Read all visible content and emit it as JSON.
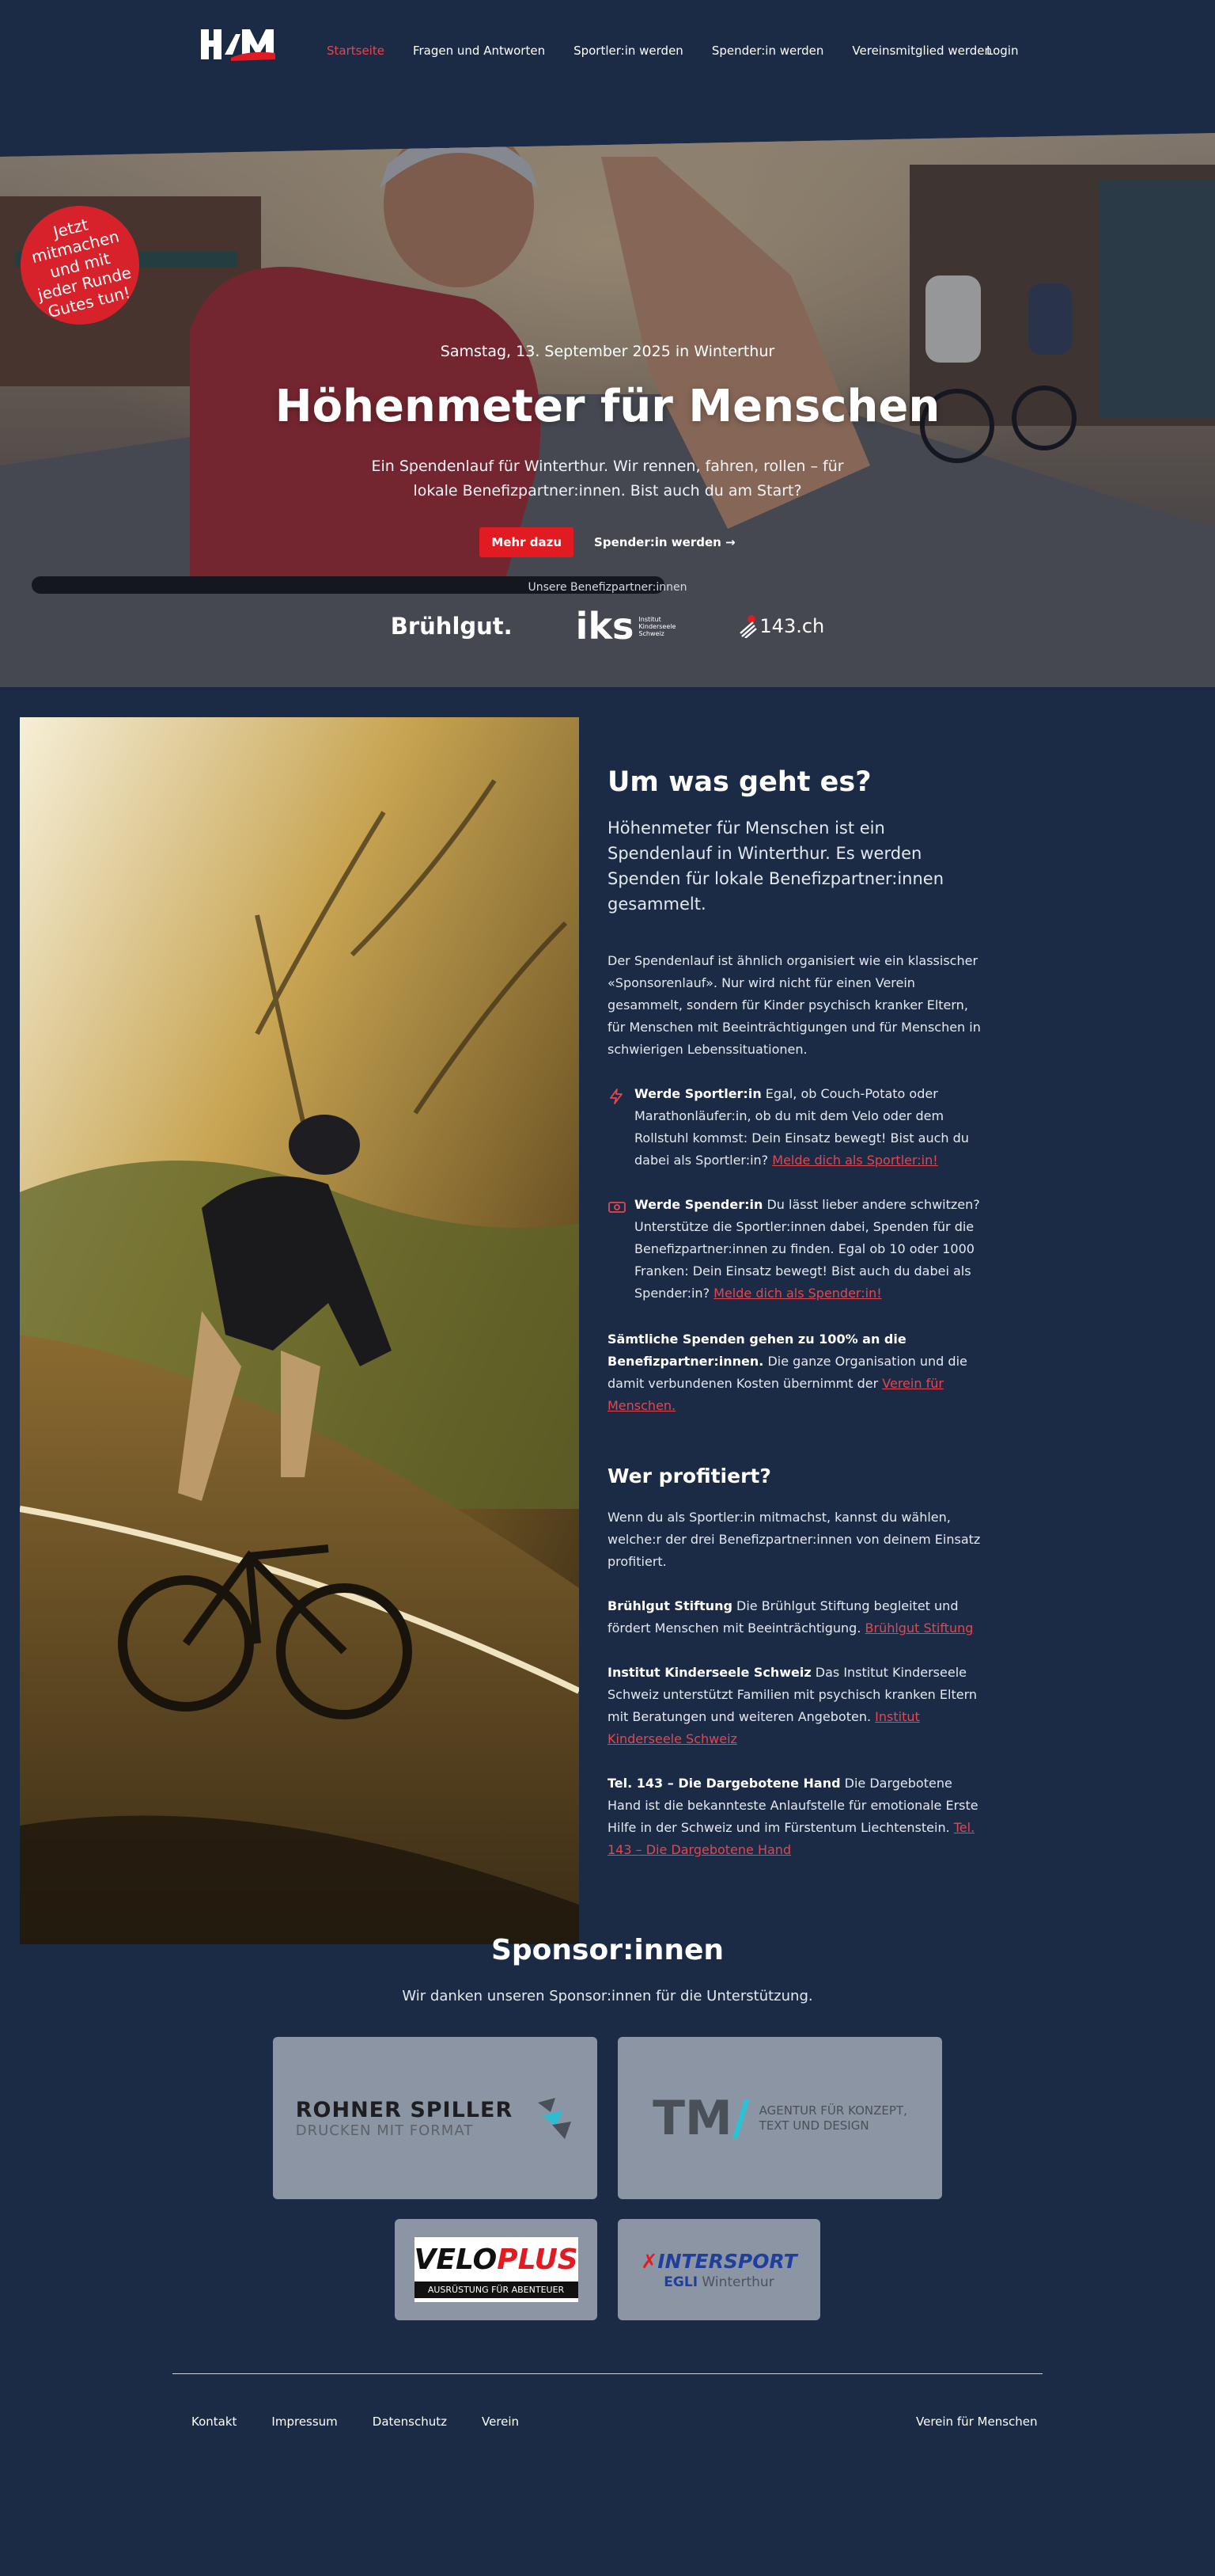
{
  "header": {
    "logo_text": "HfM",
    "nav": [
      "Startseite",
      "Fragen und Antworten",
      "Sportler:in werden",
      "Spender:in werden",
      "Vereinsmitglied werden"
    ],
    "login": "Login"
  },
  "hero": {
    "badge": "Jetzt mitmachen und mit jeder Runde Gutes tun!",
    "date": "Samstag, 13. September 2025 in Winterthur",
    "title": "Höhenmeter für Menschen",
    "text": "Ein Spendenlauf für Winterthur. Wir rennen, fahren, rollen – für lokale Benefizpartner:innen. Bist auch du am Start?",
    "btn_primary": "Mehr dazu",
    "btn_secondary": "Spender:in werden →",
    "partners_label": "Unsere Benefizpartner:innen",
    "partners": {
      "bruehlgut": "Brühlgut.",
      "iks_mark": "iks",
      "iks_line1": "Institut",
      "iks_line2": "Kinderseele",
      "iks_line3": "Schweiz",
      "tel": "143.ch"
    }
  },
  "about": {
    "title": "Um was geht es?",
    "lead": "Höhenmeter für Menschen ist ein Spendenlauf in Winterthur. Es werden Spenden für lokale Benefizpartner:innen gesammelt.",
    "p1": "Der Spendenlauf ist ähnlich organisiert wie ein klassischer «Sponsorenlauf». Nur wird nicht für einen Verein gesammelt, sondern für Kinder psychisch kranker Eltern, für Menschen mit Beeinträchtigungen und für Menschen in schwierigen Lebenssituationen.",
    "sportler_title": "Werde Sportler:in",
    "sportler_text": " Egal, ob Couch-Potato oder Marathonläufer:in, ob du mit dem Velo oder dem Rollstuhl kommst: Dein Einsatz bewegt! Bist auch du dabei als Sportler:in? ",
    "sportler_link": "Melde dich als Sportler:in!",
    "spender_title": "Werde Spender:in",
    "spender_text": " Du lässt lieber andere schwitzen? Unterstütze die Sportler:innen dabei, Spenden für die Benefizpartner:innen zu finden. Egal ob 10 oder 1000 Franken: Dein Einsatz bewegt! Bist auch du dabei als Spender:in? ",
    "spender_link": "Melde dich als Spender:in!",
    "all_bold": "Sämtliche Spenden gehen zu 100% an die Benefizpartner:innen.",
    "all_text": " Die ganze Organisation und die damit verbundenen Kosten übernimmt der ",
    "all_link": "Verein für Menschen."
  },
  "beneficiaries": {
    "title": "Wer profitiert?",
    "intro": "Wenn du als Sportler:in mitmachst, kannst du wählen, welche:r der drei Benefizpartner:innen von deinem Einsatz profitiert.",
    "items": [
      {
        "name": "Brühlgut Stiftung",
        "text": " Die Brühlgut Stiftung begleitet und fördert Menschen mit Beeinträchtigung. ",
        "link": "Brühlgut Stiftung"
      },
      {
        "name": "Institut Kinderseele Schweiz",
        "text": " Das Institut Kinderseele Schweiz unterstützt Familien mit psychisch kranken Eltern mit Beratungen und weiteren Angeboten. ",
        "link": "Institut Kinderseele Schweiz"
      },
      {
        "name": "Tel. 143 – Die Dargebotene Hand",
        "text": " Die Dargebotene Hand ist die bekannteste Anlaufstelle für emotionale Erste Hilfe in der Schweiz und im Fürstentum Liechtenstein. ",
        "link": "Tel. 143 – Die Dargebotene Hand"
      }
    ]
  },
  "sponsors": {
    "title": "Sponsor:innen",
    "subtitle": "Wir danken unseren Sponsor:innen für die Unterstützung.",
    "rohner_1": "ROHNER SPILLER",
    "rohner_2": "DRUCKEN MIT FORMAT",
    "tm_mark": "TM",
    "tm_slash": "/",
    "tm_line1": "AGENTUR FÜR KONZEPT,",
    "tm_line2": "TEXT UND DESIGN",
    "velo_1": "VELO",
    "velo_plus": "PLUS",
    "velo_2": "AUSRÜSTUNG FÜR ABENTEUER",
    "inter_x": "✗",
    "inter_1": "INTERSPORT",
    "inter_eg": "EGLI",
    "inter_2": " Winterthur"
  },
  "footer": {
    "links": [
      "Kontakt",
      "Impressum",
      "Datenschutz",
      "Verein"
    ],
    "right": "Verein für Menschen"
  }
}
